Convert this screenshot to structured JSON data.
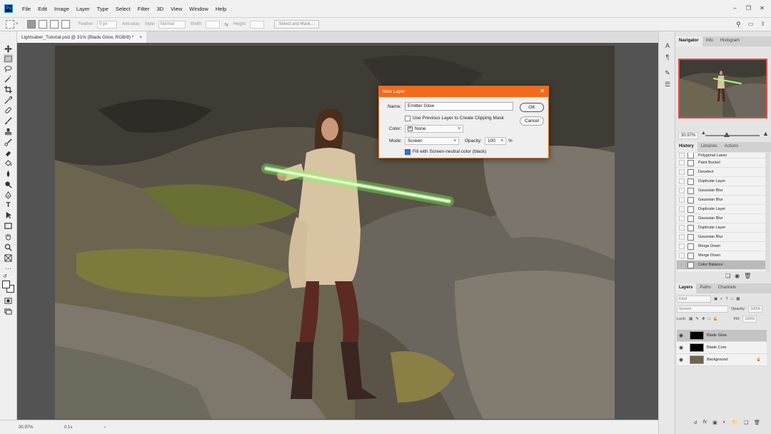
{
  "menubar": {
    "logo": "Ps",
    "items": [
      "File",
      "Edit",
      "Image",
      "Layer",
      "Type",
      "Select",
      "Filter",
      "3D",
      "View",
      "Window",
      "Help"
    ]
  },
  "options_bar": {
    "feather_label": "Feather:",
    "feather_value": "0 px",
    "antialias_label": "Anti-alias",
    "style_label": "Style:",
    "style_value": "Normal",
    "width_label": "Width:",
    "height_label": "Height:",
    "select_mask_label": "Select and Mask..."
  },
  "document_tab": {
    "title": "Lightsaber_Tutorial.psd @ 31% (Blade Glow, RGB/8) *",
    "close": "×"
  },
  "statusbar": {
    "zoom": "30.97%",
    "info": "0.1s"
  },
  "navigator_panel": {
    "tabs": [
      "Navigator",
      "Info",
      "Histogram"
    ],
    "zoom": "30.97%"
  },
  "history_panel": {
    "tabs": [
      "History",
      "Libraries",
      "Actions"
    ],
    "items": [
      {
        "label": "Polygonal Lasso"
      },
      {
        "label": "Paint Bucket"
      },
      {
        "label": "Deselect"
      },
      {
        "label": "Duplicate Layer"
      },
      {
        "label": "Gaussian Blur"
      },
      {
        "label": "Gaussian Blur"
      },
      {
        "label": "Duplicate Layer"
      },
      {
        "label": "Gaussian Blur"
      },
      {
        "label": "Duplicate Layer"
      },
      {
        "label": "Gaussian Blur"
      },
      {
        "label": "Merge Down"
      },
      {
        "label": "Merge Down"
      },
      {
        "label": "Color Balance"
      }
    ],
    "selected_index": 12
  },
  "layers_panel": {
    "tabs": [
      "Layers",
      "Paths",
      "Channels"
    ],
    "kind_label": "Kind",
    "blend_mode": "Screen",
    "opacity_label": "Opacity:",
    "opacity_value": "100%",
    "lock_label": "Lock:",
    "fill_label": "Fill:",
    "fill_value": "100%",
    "layers": [
      {
        "name": "Blade Glow",
        "selected": true,
        "italic": false
      },
      {
        "name": "Blade Core",
        "selected": false,
        "italic": false
      },
      {
        "name": "Background",
        "selected": false,
        "italic": true
      }
    ]
  },
  "dialog": {
    "title": "New Layer",
    "name_label": "Name:",
    "name_value": "Emitter Glow",
    "clipping_label": "Use Previous Layer to Create Clipping Mask",
    "clipping_checked": false,
    "color_label": "Color:",
    "color_value": "None",
    "mode_label": "Mode:",
    "mode_value": "Screen",
    "opacity_label": "Opacity:",
    "opacity_value": "100",
    "percent": "%",
    "fill_neutral_label": "Fill with Screen-neutral color (black)",
    "fill_neutral_checked": true,
    "ok_label": "OK",
    "cancel_label": "Cancel"
  }
}
